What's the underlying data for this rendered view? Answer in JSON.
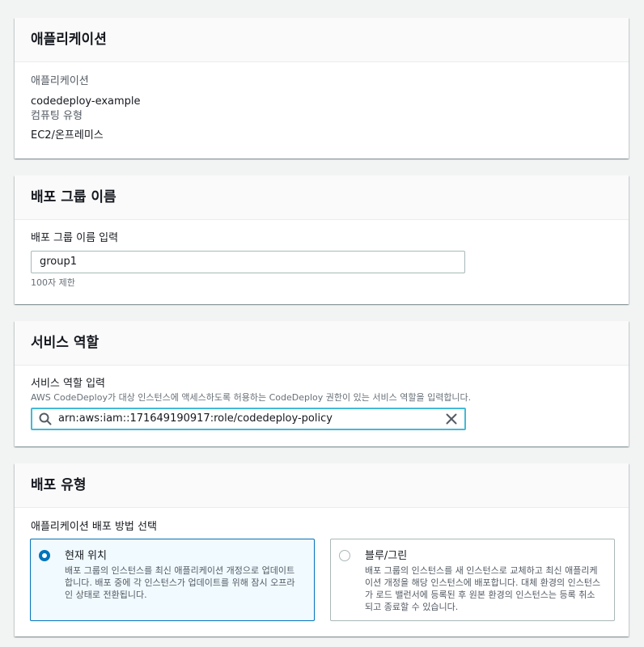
{
  "application_panel": {
    "title": "애플리케이션",
    "app_label": "애플리케이션",
    "app_value": "codedeploy-example",
    "platform_label": "컴퓨팅 유형",
    "platform_value": "EC2/온프레미스"
  },
  "group_panel": {
    "title": "배포 그룹 이름",
    "field_label": "배포 그룹 이름 입력",
    "value": "group1",
    "constraint": "100자 제한"
  },
  "role_panel": {
    "title": "서비스 역할",
    "field_label": "서비스 역할 입력",
    "description": "AWS CodeDeploy가 대상 인스턴스에 액세스하도록 허용하는 CodeDeploy 권한이 있는 서비스 역할을 입력합니다.",
    "value": "arn:aws:iam::171649190917:role/codedeploy-policy",
    "search_icon": "search-icon",
    "clear_icon": "close-icon"
  },
  "type_panel": {
    "title": "배포 유형",
    "field_label": "애플리케이션 배포 방법 선택",
    "options": [
      {
        "label": "현재 위치",
        "description": "배포 그룹의 인스턴스를 최신 애플리케이션 개정으로 업데이트합니다. 배포 중에 각 인스턴스가 업데이트를 위해 잠시 오프라인 상태로 전환됩니다.",
        "selected": true
      },
      {
        "label": "블루/그린",
        "description": "배포 그룹의 인스턴스를 새 인스턴스로 교체하고 최신 애플리케이션 개정을 해당 인스턴스에 배포합니다. 대체 환경의 인스턴스가 로드 밸런서에 등록된 후 원본 환경의 인스턴스는 등록 취소되고 종료할 수 있습니다.",
        "selected": false
      }
    ]
  },
  "colors": {
    "accent": "#0073bb",
    "focus": "#44b9d6",
    "background": "#f2f3f3"
  }
}
